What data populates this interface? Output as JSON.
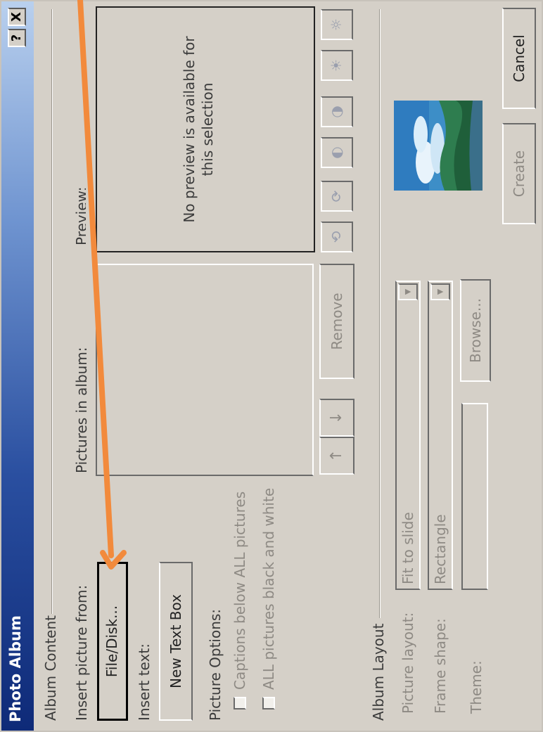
{
  "window": {
    "title": "Photo Album",
    "help_glyph": "?",
    "close_glyph": "X"
  },
  "album_content": {
    "group_label": "Album Content",
    "insert_picture_label": "Insert picture from:",
    "file_disk_button": "File/Disk...",
    "insert_text_label": "Insert text:",
    "new_text_box_button": "New Text Box",
    "picture_options_label": "Picture Options:",
    "captions_checkbox": {
      "label": "Captions below ALL pictures",
      "checked": false
    },
    "bw_checkbox": {
      "label": "ALL pictures black and white",
      "checked": false
    },
    "pictures_in_album_label": "Pictures in album:",
    "remove_button": "Remove",
    "move_up_glyph": "↑",
    "move_down_glyph": "↓",
    "preview_label": "Preview:",
    "preview_message": "No preview is available for this selection",
    "tools": [
      {
        "name": "rotate-left-icon",
        "glyph": "⟲"
      },
      {
        "name": "rotate-right-icon",
        "glyph": "⟳"
      },
      {
        "name": "more-contrast-icon",
        "glyph": "◐"
      },
      {
        "name": "less-contrast-icon",
        "glyph": "◑"
      },
      {
        "name": "more-brightness-icon",
        "glyph": "☀"
      },
      {
        "name": "less-brightness-icon",
        "glyph": "☼"
      }
    ]
  },
  "album_layout": {
    "group_label": "Album Layout",
    "picture_layout_label": "Picture layout:",
    "picture_layout_value": "Fit to slide",
    "frame_shape_label": "Frame shape:",
    "frame_shape_value": "Rectangle",
    "theme_label": "Theme:",
    "theme_value": "",
    "browse_button": "Browse..."
  },
  "footer": {
    "create_button": "Create",
    "cancel_button": "Cancel"
  },
  "annotation": {
    "arrow_color": "#f28a3c"
  }
}
